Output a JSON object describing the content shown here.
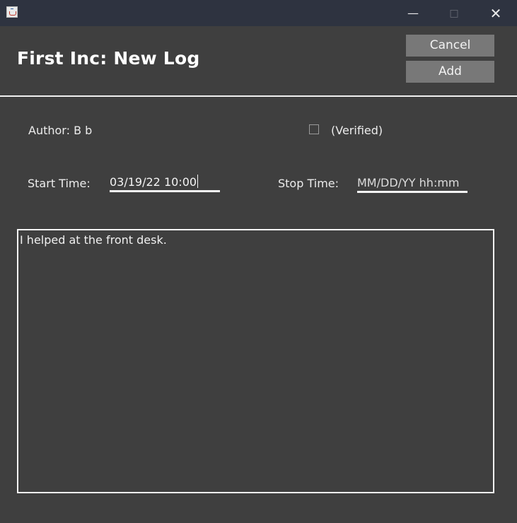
{
  "window": {
    "minimize_glyph": "—",
    "maximize_glyph": "□",
    "close_glyph": "✕"
  },
  "header": {
    "title": "First Inc: New Log",
    "cancel_label": "Cancel",
    "add_label": "Add"
  },
  "form": {
    "author_label": "Author: B b",
    "verified_label": "(Verified)",
    "verified_checked": false,
    "start_label": "Start Time:",
    "start_value": "03/19/22 10:00",
    "stop_label": "Stop Time:",
    "stop_placeholder": "MM/DD/YY hh:mm",
    "description": "I helped at the front desk."
  },
  "colors": {
    "titlebar": "#2e3340",
    "background": "#3f3f3f",
    "button": "#787878"
  }
}
